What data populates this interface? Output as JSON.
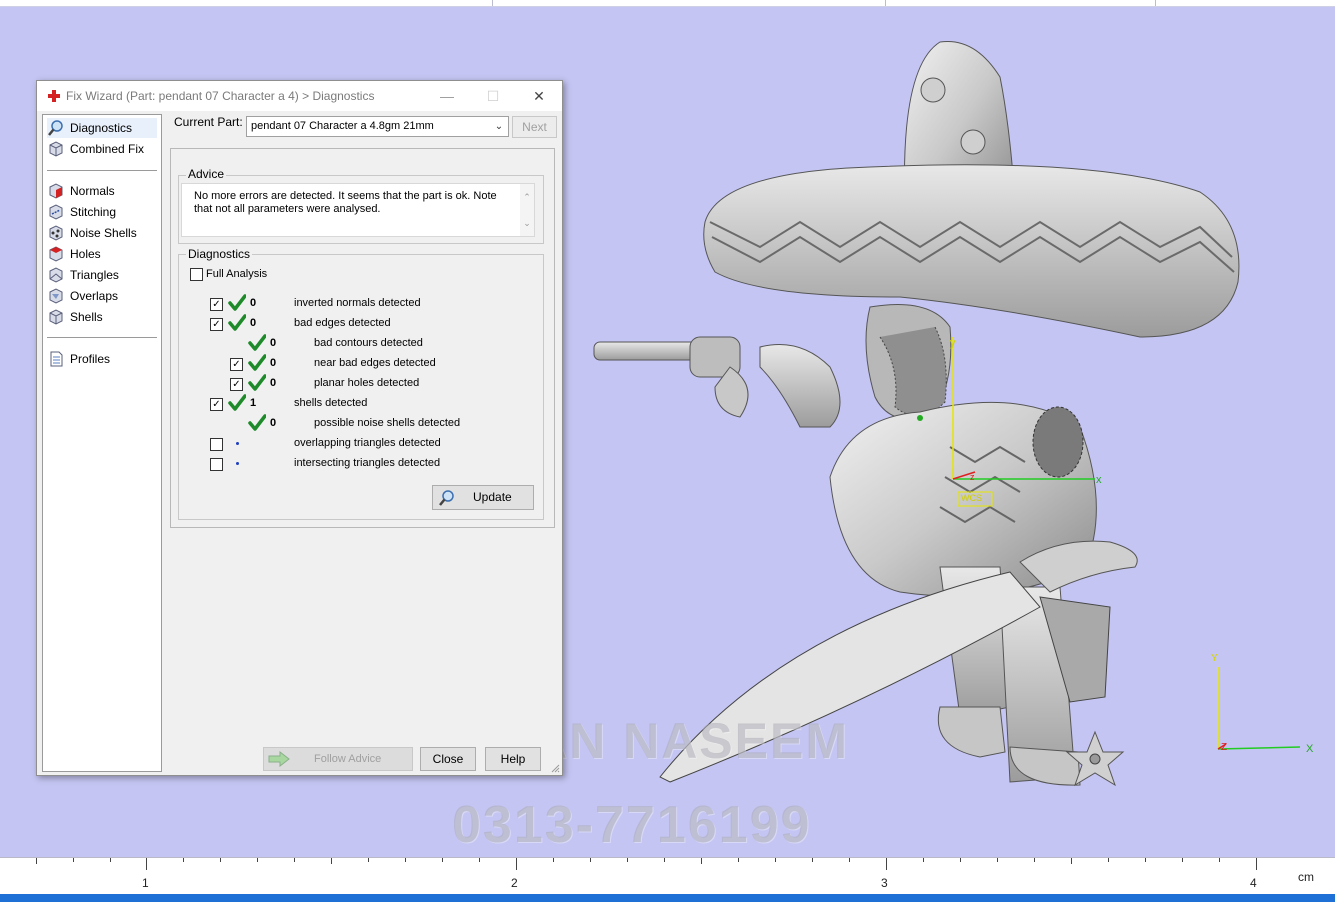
{
  "dialog": {
    "title": "Fix Wizard (Part: pendant 07 Character a 4) > Diagnostics",
    "window_controls": {
      "minimize": "—",
      "maximize": "☐",
      "close": "✕"
    }
  },
  "nav": {
    "top_items": [
      {
        "label": "Diagnostics",
        "icon": "magnifier-icon",
        "active": true
      },
      {
        "label": "Combined Fix",
        "icon": "cube-icon"
      }
    ],
    "fix_items": [
      {
        "label": "Normals",
        "icon": "normals-cube-icon"
      },
      {
        "label": "Stitching",
        "icon": "stitching-cube-icon"
      },
      {
        "label": "Noise Shells",
        "icon": "noise-shells-icon"
      },
      {
        "label": "Holes",
        "icon": "holes-cube-icon"
      },
      {
        "label": "Triangles",
        "icon": "triangles-cube-icon"
      },
      {
        "label": "Overlaps",
        "icon": "overlaps-cube-icon"
      },
      {
        "label": "Shells",
        "icon": "shells-cube-icon"
      }
    ],
    "bottom_items": [
      {
        "label": "Profiles",
        "icon": "document-icon"
      }
    ]
  },
  "current_part": {
    "label": "Current Part:",
    "value": "pendant 07 Character a 4.8gm 21mm",
    "next_label": "Next"
  },
  "advice": {
    "legend": "Advice",
    "text": "No more errors are detected. It seems that the part is ok. Note that not all parameters were analysed."
  },
  "diagnostics": {
    "legend": "Diagnostics",
    "full_analysis_label": "Full Analysis",
    "full_analysis_checked": false,
    "rows": [
      {
        "checkbox": true,
        "checked": true,
        "status": "ok",
        "count": "0",
        "label": "inverted normals detected",
        "indent": 0
      },
      {
        "checkbox": true,
        "checked": true,
        "status": "ok",
        "count": "0",
        "label": "bad edges detected",
        "indent": 0
      },
      {
        "checkbox": false,
        "checked": false,
        "status": "ok",
        "count": "0",
        "label": "bad contours detected",
        "indent": 1
      },
      {
        "checkbox": true,
        "checked": true,
        "status": "ok",
        "count": "0",
        "label": "near bad edges detected",
        "indent": 1
      },
      {
        "checkbox": true,
        "checked": true,
        "status": "ok",
        "count": "0",
        "label": "planar holes detected",
        "indent": 1
      },
      {
        "checkbox": true,
        "checked": true,
        "status": "ok",
        "count": "1",
        "label": "shells detected",
        "indent": 0
      },
      {
        "checkbox": false,
        "checked": false,
        "status": "ok",
        "count": "0",
        "label": "possible noise shells detected",
        "indent": 1
      },
      {
        "checkbox": true,
        "checked": false,
        "status": "dot",
        "count": "",
        "label": "overlapping triangles detected",
        "indent": 0
      },
      {
        "checkbox": true,
        "checked": false,
        "status": "dot",
        "count": "",
        "label": "intersecting triangles detected",
        "indent": 0
      }
    ],
    "update_label": "Update"
  },
  "footer": {
    "follow_advice_label": "Follow Advice",
    "close_label": "Close",
    "help_label": "Help"
  },
  "viewport": {
    "background": "#c4c5f2",
    "axis_labels": {
      "x": "x",
      "y": "y",
      "z": "z",
      "mini_x": "X",
      "mini_y": "Y",
      "mini_z": "Z"
    },
    "wcs_label": "WCS"
  },
  "ruler": {
    "labels": [
      "1",
      "2",
      "3",
      "4"
    ],
    "unit": "cm"
  },
  "watermark": {
    "line1": "RIZWAN NASEEM",
    "line2": "0313-7716199"
  },
  "colors": {
    "check_green": "#1e8a2a",
    "status_blue": "#1e6fd6",
    "fix_red": "#d42222"
  }
}
